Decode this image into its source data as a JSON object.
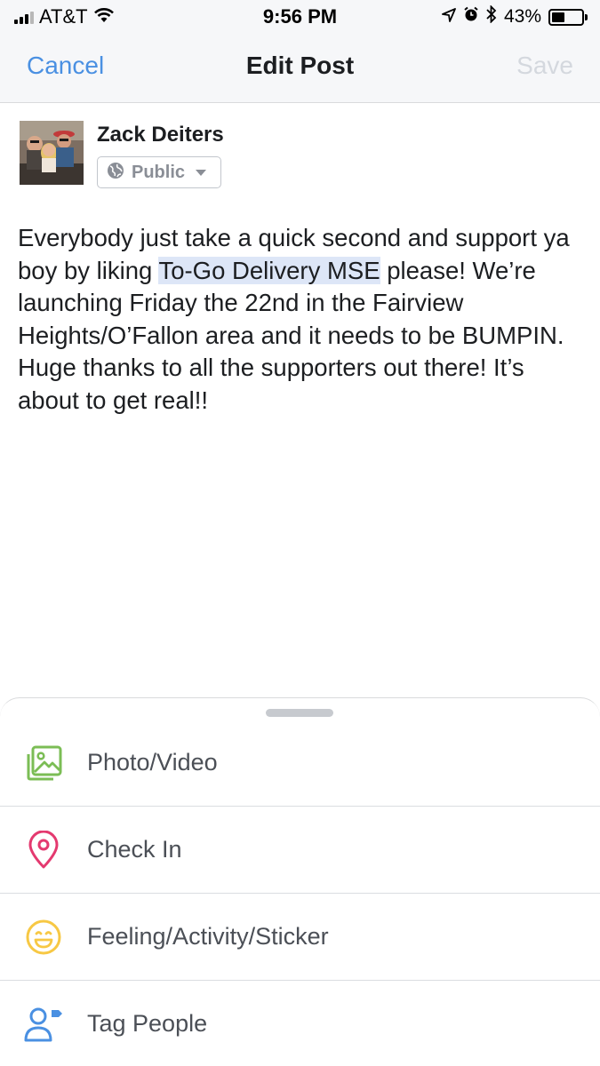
{
  "status_bar": {
    "carrier": "AT&T",
    "time": "9:56 PM",
    "battery_percent_label": "43%",
    "battery_level": 0.43,
    "signal_bars": 3,
    "icons": [
      "signal-icon",
      "wifi-icon",
      "location-icon",
      "alarm-icon",
      "bluetooth-icon",
      "battery-icon"
    ]
  },
  "nav": {
    "cancel_label": "Cancel",
    "title": "Edit Post",
    "save_label": "Save"
  },
  "author": {
    "name": "Zack Deiters",
    "privacy_label": "Public"
  },
  "post": {
    "text_before": "Everybody just take a quick second and support ya boy by liking ",
    "highlighted_text": "To-Go Delivery MSE",
    "text_after": " please! We’re launching Friday the 22nd in the Fairview Heights/O’Fallon area and it needs to be BUMPIN. Huge thanks to all the supporters out there! It’s about to get real!!"
  },
  "menu": {
    "items": [
      {
        "label": "Photo/Video",
        "icon": "photo-video-icon",
        "color": "#7bbd55"
      },
      {
        "label": "Check In",
        "icon": "location-pin-icon",
        "color": "#e4396f"
      },
      {
        "label": "Feeling/Activity/Sticker",
        "icon": "smiley-icon",
        "color": "#f7c844"
      },
      {
        "label": "Tag People",
        "icon": "tag-people-icon",
        "color": "#4a90e2"
      }
    ]
  },
  "colors": {
    "accent": "#4a90e2",
    "save_disabled": "#d4d8de",
    "highlight": "#dde6f7"
  }
}
